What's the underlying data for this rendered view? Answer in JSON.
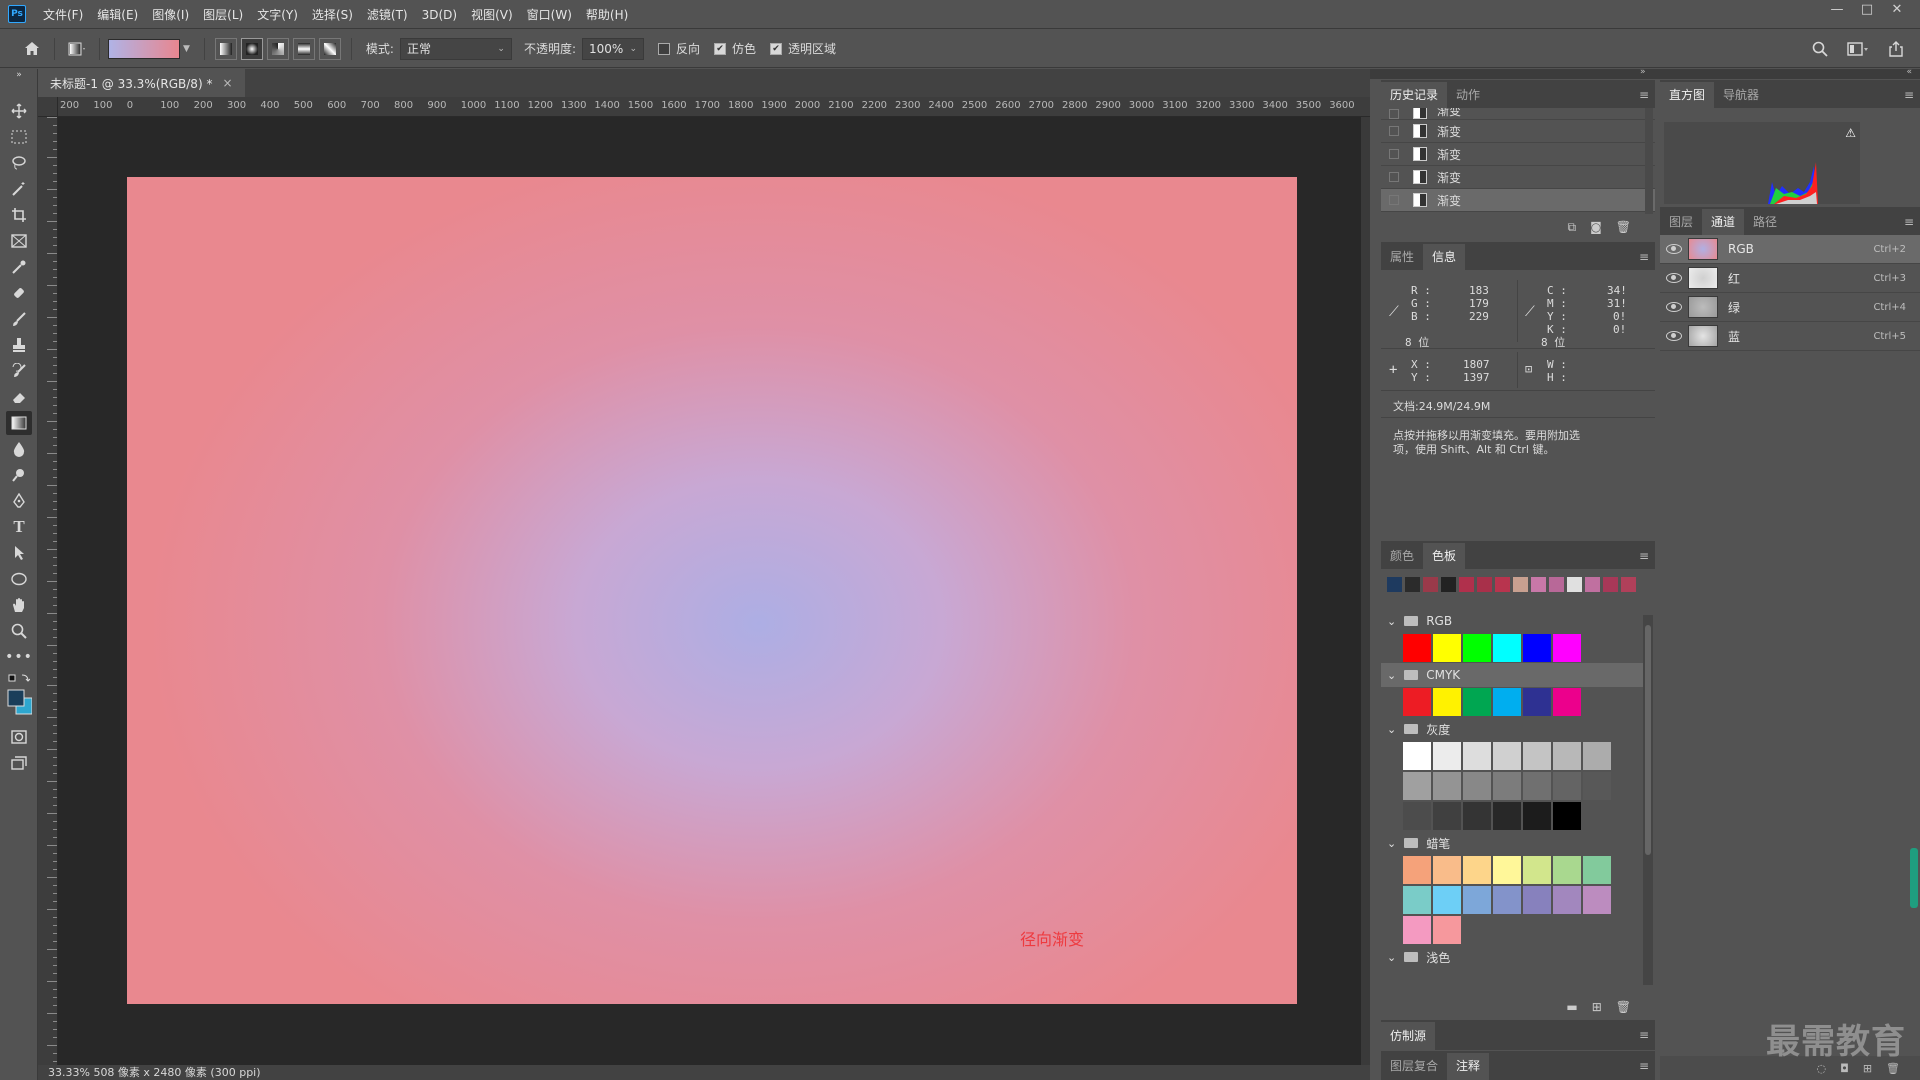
{
  "menubar": {
    "logo": "Ps",
    "items": [
      "文件(F)",
      "编辑(E)",
      "图像(I)",
      "图层(L)",
      "文字(Y)",
      "选择(S)",
      "滤镜(T)",
      "3D(D)",
      "视图(V)",
      "窗口(W)",
      "帮助(H)"
    ],
    "win_minimize": "—",
    "win_restore": "□",
    "win_close": "✕"
  },
  "options": {
    "mode_label": "模式:",
    "mode_value": "正常",
    "opacity_label": "不透明度:",
    "opacity_value": "100%",
    "reverse_label": "反向",
    "reverse_checked": false,
    "dither_label": "仿色",
    "dither_checked": true,
    "transparency_label": "透明区域",
    "transparency_checked": true,
    "gradient_colors": [
      "#b0b3e6",
      "#e8868f"
    ]
  },
  "document": {
    "tab_title": "未标题-1 @ 33.3%(RGB/8) *",
    "tab_close": "×",
    "ruler_ticks": [
      "200",
      "100",
      "0",
      "100",
      "200",
      "300",
      "400",
      "500",
      "600",
      "700",
      "800",
      "900",
      "1000",
      "1100",
      "1200",
      "1300",
      "1400",
      "1500",
      "1600",
      "1700",
      "1800",
      "1900",
      "2000",
      "2100",
      "2200",
      "2300",
      "2400",
      "2500",
      "2600",
      "2700",
      "2800",
      "2900",
      "3000",
      "3100",
      "3200",
      "3300",
      "3400",
      "3500",
      "3600"
    ],
    "canvas_note": "径向渐变",
    "status": "33.33%  508 像素 x 2480 像素 (300 ppi)",
    "gradient_center": "#adaee4",
    "gradient_edge": "#e9888f"
  },
  "history": {
    "tabs": [
      "历史记录",
      "动作"
    ],
    "rows": [
      "渐变",
      "渐变",
      "渐变",
      "渐变",
      "渐变"
    ]
  },
  "info": {
    "tabs": [
      "属性",
      "信息"
    ],
    "r_label": "R :",
    "r": "183",
    "g_label": "G :",
    "g": "179",
    "b_label": "B :",
    "b": "229",
    "c_label": "C :",
    "c": "34!",
    "m_label": "M :",
    "m": "31!",
    "y_label": "Y :",
    "y": "0!",
    "k_label": "K :",
    "k": "0!",
    "bits_left": "8 位",
    "bits_right": "8 位",
    "x_label": "X :",
    "x": "1807",
    "y2_label": "Y :",
    "y2": "1397",
    "w_label": "W :",
    "h_label": "H :",
    "doc_size": "文档:24.9M/24.9M",
    "hint_line1": "点按并拖移以用渐变填充。要用附加选",
    "hint_line2": "项，使用 Shift、Alt 和 Ctrl 键。"
  },
  "swatches": {
    "tabs": [
      "颜色",
      "色板"
    ],
    "recent": [
      "#1e3a5f",
      "#2b2b2b",
      "#9a3a4a",
      "#222222",
      "#b0304c",
      "#a8304a",
      "#b8344e",
      "#c8a090",
      "#c878a8",
      "#b86898",
      "#e0e0e0",
      "#c070a0",
      "#a83858",
      "#b0405a"
    ],
    "groups": [
      {
        "name": "RGB",
        "rows": [
          [
            "#ff0000",
            "#ffff00",
            "#00ff00",
            "#00ffff",
            "#0000ff",
            "#ff00ff"
          ]
        ]
      },
      {
        "name": "CMYK",
        "rows": [
          [
            "#ed1c24",
            "#fff200",
            "#00a651",
            "#00aeef",
            "#2e3192",
            "#ec008c"
          ]
        ]
      },
      {
        "name": "灰度",
        "rows": [
          [
            "#ffffff",
            "#ececec",
            "#dddddd",
            "#d0d0d0",
            "#c4c4c4",
            "#b8b8b8",
            "#acacac"
          ],
          [
            "#a0a0a0",
            "#949494",
            "#888888",
            "#7c7c7c",
            "#707070",
            "#646464",
            "#585858"
          ],
          [
            "#4c4c4c",
            "#404040",
            "#343434",
            "#282828",
            "#1c1c1c",
            "#000000"
          ]
        ]
      },
      {
        "name": "蜡笔",
        "rows": [
          [
            "#f5a27a",
            "#f9bc8a",
            "#fdd58a",
            "#fff799",
            "#d2e68c",
            "#a9d88f",
            "#82ca9c"
          ],
          [
            "#7accc8",
            "#6dcff6",
            "#7da7d9",
            "#8393ca",
            "#8781bd",
            "#a287be",
            "#bc8cbf"
          ],
          [
            "#f49ac1",
            "#f6989d"
          ]
        ]
      },
      {
        "name": "浅色",
        "rows": []
      }
    ]
  },
  "clone": {
    "tab": "仿制源"
  },
  "comps": {
    "tabs": [
      "图层复合",
      "注释"
    ]
  },
  "histogram": {
    "tabs": [
      "直方图",
      "导航器"
    ]
  },
  "channels": {
    "tabs": [
      "图层",
      "通道",
      "路径"
    ],
    "rows": [
      {
        "name": "RGB",
        "shortcut": "Ctrl+2"
      },
      {
        "name": "红",
        "shortcut": "Ctrl+3"
      },
      {
        "name": "绿",
        "shortcut": "Ctrl+4"
      },
      {
        "name": "蓝",
        "shortcut": "Ctrl+5"
      }
    ]
  },
  "watermark": "最需教育"
}
